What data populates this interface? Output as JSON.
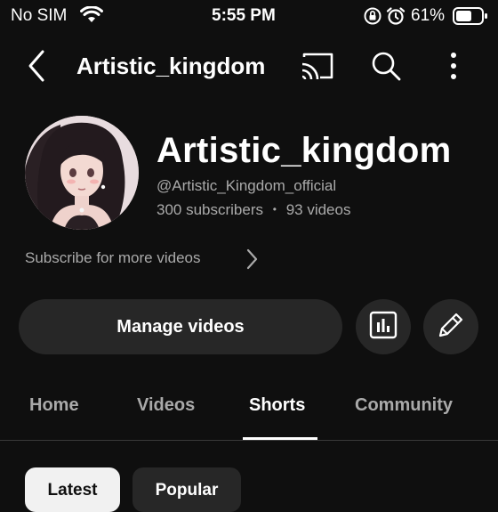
{
  "status_bar": {
    "carrier": "No SIM",
    "time": "5:55 PM",
    "battery": "61%"
  },
  "header": {
    "title": "Artistic_kingdom",
    "icons": [
      "back-icon",
      "cast-icon",
      "search-icon",
      "more-vert-icon"
    ]
  },
  "channel": {
    "name": "Artistic_kingdom",
    "handle": "@Artistic_Kingdom_official",
    "subscribers": "300 subscribers",
    "separator": "•",
    "videos": "93 videos",
    "subscribe_prompt": "Subscribe for more videos"
  },
  "actions": {
    "manage_label": "Manage videos",
    "icons": [
      "analytics-icon",
      "edit-pencil-icon"
    ]
  },
  "tabs": [
    {
      "label": "Home"
    },
    {
      "label": "Videos"
    },
    {
      "label": "Shorts",
      "active": true
    },
    {
      "label": "Community"
    }
  ],
  "chips": [
    {
      "label": "Latest",
      "selected": true
    },
    {
      "label": "Popular"
    }
  ],
  "colors": {
    "background": "#0f0f0f",
    "surface": "#272727",
    "secondary_text": "#aaaaaa",
    "chip_selected": "#f1f1f1"
  }
}
